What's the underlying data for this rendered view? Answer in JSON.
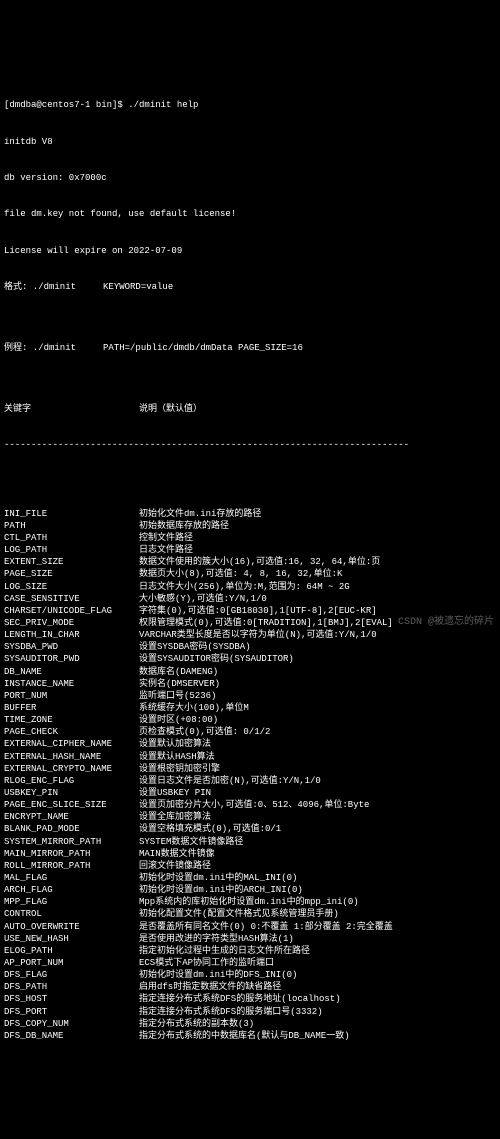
{
  "header": {
    "prompt": "[dmdba@centos7-1 bin]$ ./dminit help",
    "line2": "initdb V8",
    "line3": "db version: 0x7000c",
    "line4": "file dm.key not found, use default license!",
    "line5": "License will expire on 2022-07-09",
    "line6": "格式: ./dminit     KEYWORD=value",
    "line7": "",
    "line8": "例程: ./dminit     PATH=/public/dmdb/dmData PAGE_SIZE=16",
    "line9": "",
    "cols_kw": "关键字",
    "cols_desc": "说明（默认值）",
    "sep": "---------------------------------------------------------------------------"
  },
  "rows": [
    {
      "kw": "INI_FILE",
      "desc": "初始化文件dm.ini存放的路径"
    },
    {
      "kw": "PATH",
      "desc": "初始数据库存放的路径"
    },
    {
      "kw": "CTL_PATH",
      "desc": "控制文件路径"
    },
    {
      "kw": "LOG_PATH",
      "desc": "日志文件路径"
    },
    {
      "kw": "EXTENT_SIZE",
      "desc": "数据文件使用的簇大小(16),可选值:16, 32, 64,单位:页"
    },
    {
      "kw": "PAGE_SIZE",
      "desc": "数据页大小(8),可选值: 4, 8, 16, 32,单位:K"
    },
    {
      "kw": "LOG_SIZE",
      "desc": "日志文件大小(256),单位为:M,范围为: 64M ~ 2G"
    },
    {
      "kw": "CASE_SENSITIVE",
      "desc": "大小敏感(Y),可选值:Y/N,1/0"
    },
    {
      "kw": "CHARSET/UNICODE_FLAG",
      "desc": "字符集(0),可选值:0[GB18030],1[UTF-8],2[EUC-KR]"
    },
    {
      "kw": "SEC_PRIV_MODE",
      "desc": "权限管理模式(0),可选值:0[TRADITION],1[BMJ],2[EVAL]"
    },
    {
      "kw": "LENGTH_IN_CHAR",
      "desc": "VARCHAR类型长度是否以字符为单位(N),可选值:Y/N,1/0"
    },
    {
      "kw": "SYSDBA_PWD",
      "desc": "设置SYSDBA密码(SYSDBA)"
    },
    {
      "kw": "SYSAUDITOR_PWD",
      "desc": "设置SYSAUDITOR密码(SYSAUDITOR)"
    },
    {
      "kw": "DB_NAME",
      "desc": "数据库名(DAMENG)"
    },
    {
      "kw": "INSTANCE_NAME",
      "desc": "实例名(DMSERVER)"
    },
    {
      "kw": "PORT_NUM",
      "desc": "监听端口号(5236)"
    },
    {
      "kw": "BUFFER",
      "desc": "系统缓存大小(100),单位M"
    },
    {
      "kw": "TIME_ZONE",
      "desc": "设置时区(+08:00)"
    },
    {
      "kw": "PAGE_CHECK",
      "desc": "页检查模式(0),可选值: 0/1/2"
    },
    {
      "kw": "EXTERNAL_CIPHER_NAME",
      "desc": "设置默认加密算法"
    },
    {
      "kw": "EXTERNAL_HASH_NAME",
      "desc": "设置默认HASH算法"
    },
    {
      "kw": "EXTERNAL_CRYPTO_NAME",
      "desc": "设置根密钥加密引擎"
    },
    {
      "kw": "RLOG_ENC_FLAG",
      "desc": "设置日志文件是否加密(N),可选值:Y/N,1/0"
    },
    {
      "kw": "USBKEY_PIN",
      "desc": "设置USBKEY PIN"
    },
    {
      "kw": "PAGE_ENC_SLICE_SIZE",
      "desc": "设置页加密分片大小,可选值:0、512、4096,单位:Byte"
    },
    {
      "kw": "ENCRYPT_NAME",
      "desc": "设置全库加密算法"
    },
    {
      "kw": "BLANK_PAD_MODE",
      "desc": "设置空格填充模式(0),可选值:0/1"
    },
    {
      "kw": "SYSTEM_MIRROR_PATH",
      "desc": "SYSTEM数据文件镜像路径"
    },
    {
      "kw": "MAIN_MIRROR_PATH",
      "desc": "MAIN数据文件镜像"
    },
    {
      "kw": "ROLL_MIRROR_PATH",
      "desc": "回滚文件镜像路径"
    },
    {
      "kw": "MAL_FLAG",
      "desc": "初始化时设置dm.ini中的MAL_INI(0)"
    },
    {
      "kw": "ARCH_FLAG",
      "desc": "初始化时设置dm.ini中的ARCH_INI(0)"
    },
    {
      "kw": "MPP_FLAG",
      "desc": "Mpp系统内的库初始化时设置dm.ini中的mpp_ini(0)"
    },
    {
      "kw": "CONTROL",
      "desc": "初始化配置文件(配置文件格式见系统管理员手册)"
    },
    {
      "kw": "AUTO_OVERWRITE",
      "desc": "是否覆盖所有同名文件(0) 0:不覆盖 1:部分覆盖 2:完全覆盖"
    },
    {
      "kw": "USE_NEW_HASH",
      "desc": "是否使用改进的字符类型HASH算法(1)"
    },
    {
      "kw": "ELOG_PATH",
      "desc": "指定初始化过程中生成的日志文件所在路径"
    },
    {
      "kw": "AP_PORT_NUM",
      "desc": "ECS模式下AP协同工作的监听端口"
    },
    {
      "kw": "DFS_FLAG",
      "desc": "初始化时设置dm.ini中的DFS_INI(0)"
    },
    {
      "kw": "DFS_PATH",
      "desc": "启用dfs时指定数据文件的缺省路径"
    },
    {
      "kw": "DFS_HOST",
      "desc": "指定连接分布式系统DFS的服务地址(localhost)"
    },
    {
      "kw": "DFS_PORT",
      "desc": "指定连接分布式系统DFS的服务端口号(3332)"
    },
    {
      "kw": "DFS_COPY_NUM",
      "desc": "指定分布式系统的副本数(3)"
    },
    {
      "kw": "DFS_DB_NAME",
      "desc": "指定分布式系统的中数据库名(默认与DB_NAME一致)"
    }
  ],
  "watermark": {
    "label": "CSDN @被遗忘的碎片"
  }
}
